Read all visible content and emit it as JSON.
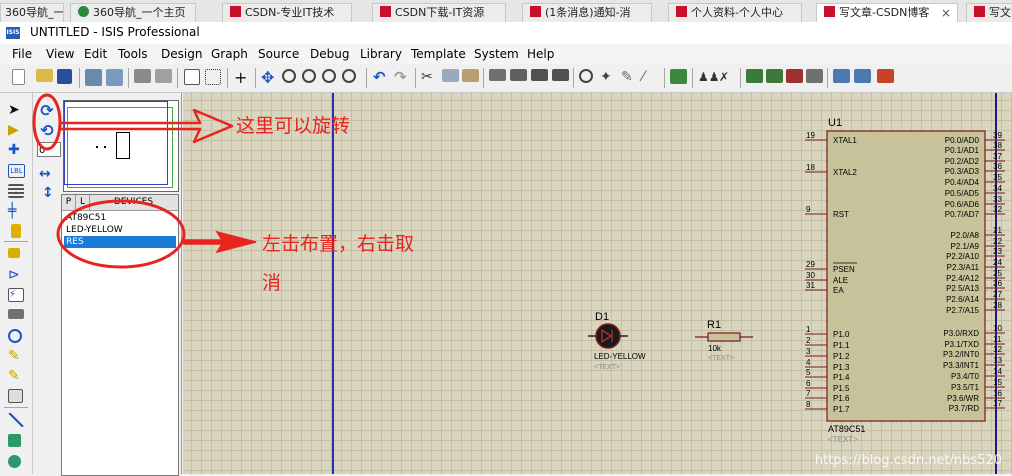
{
  "browser_tabs": [
    {
      "label": "360导航_一个主页"
    },
    {
      "label": "CSDN-专业IT技术"
    },
    {
      "label": "CSDN下载-IT资源"
    },
    {
      "label": "(1条消息)通知-消"
    },
    {
      "label": "个人资料-个人中心"
    },
    {
      "label": "写文章-CSDN博客",
      "close": "×"
    },
    {
      "label": "写文"
    }
  ],
  "window": {
    "icon_label": "ISIS",
    "title": "UNTITLED - ISIS Professional"
  },
  "menu": [
    "File",
    "View",
    "Edit",
    "Tools",
    "Design",
    "Graph",
    "Source",
    "Debug",
    "Library",
    "Template",
    "System",
    "Help"
  ],
  "panel": {
    "rotation_value": "0",
    "list_headers": [
      "P",
      "L",
      "DEVICES"
    ],
    "devices": [
      "AT89C51",
      "LED-YELLOW",
      "RES"
    ],
    "selected_device": "RES"
  },
  "mode_labels": {
    "label_mode": "LBL"
  },
  "schematic": {
    "u1": {
      "ref": "U1",
      "part": "AT89C51",
      "text_placeholder": "<TEXT>",
      "left_pins": [
        {
          "num": "19",
          "name": "XTAL1"
        },
        {
          "num": "18",
          "name": "XTAL2"
        },
        {
          "num": "9",
          "name": "RST"
        },
        {
          "num": "29",
          "name": "PSEN"
        },
        {
          "num": "30",
          "name": "ALE"
        },
        {
          "num": "31",
          "name": "EA"
        },
        {
          "num": "1",
          "name": "P1.0"
        },
        {
          "num": "2",
          "name": "P1.1"
        },
        {
          "num": "3",
          "name": "P1.2"
        },
        {
          "num": "4",
          "name": "P1.3"
        },
        {
          "num": "5",
          "name": "P1.4"
        },
        {
          "num": "6",
          "name": "P1.5"
        },
        {
          "num": "7",
          "name": "P1.6"
        },
        {
          "num": "8",
          "name": "P1.7"
        }
      ],
      "right_pins": [
        {
          "num": "39",
          "name": "P0.0/AD0"
        },
        {
          "num": "38",
          "name": "P0.1/AD1"
        },
        {
          "num": "37",
          "name": "P0.2/AD2"
        },
        {
          "num": "36",
          "name": "P0.3/AD3"
        },
        {
          "num": "35",
          "name": "P0.4/AD4"
        },
        {
          "num": "34",
          "name": "P0.5/AD5"
        },
        {
          "num": "33",
          "name": "P0.6/AD6"
        },
        {
          "num": "32",
          "name": "P0.7/AD7"
        },
        {
          "num": "21",
          "name": "P2.0/A8"
        },
        {
          "num": "22",
          "name": "P2.1/A9"
        },
        {
          "num": "23",
          "name": "P2.2/A10"
        },
        {
          "num": "24",
          "name": "P2.3/A11"
        },
        {
          "num": "25",
          "name": "P2.4/A12"
        },
        {
          "num": "26",
          "name": "P2.5/A13"
        },
        {
          "num": "27",
          "name": "P2.6/A14"
        },
        {
          "num": "28",
          "name": "P2.7/A15"
        },
        {
          "num": "10",
          "name": "P3.0/RXD"
        },
        {
          "num": "11",
          "name": "P3.1/TXD"
        },
        {
          "num": "12",
          "name": "P3.2/INT0"
        },
        {
          "num": "13",
          "name": "P3.3/INT1"
        },
        {
          "num": "14",
          "name": "P3.4/T0"
        },
        {
          "num": "15",
          "name": "P3.5/T1"
        },
        {
          "num": "16",
          "name": "P3.6/WR"
        },
        {
          "num": "17",
          "name": "P3.7/RD"
        }
      ]
    },
    "d1": {
      "ref": "D1",
      "part": "LED-YELLOW",
      "text_placeholder": "<TEXT>"
    },
    "r1": {
      "ref": "R1",
      "value": "10k",
      "text_placeholder": "<TEXT>"
    },
    "watermark": "https://blog.csdn.net/nbs520"
  },
  "annotations": {
    "rotate_hint": "这里可以旋转",
    "place_hint_line1": "左击布置，右击取",
    "place_hint_line2": "消"
  },
  "colors": {
    "annotation": "#e8241f",
    "sheet": "#d9d5bf",
    "component_outline": "#8b1e1e",
    "selection": "#1a7bd6"
  }
}
